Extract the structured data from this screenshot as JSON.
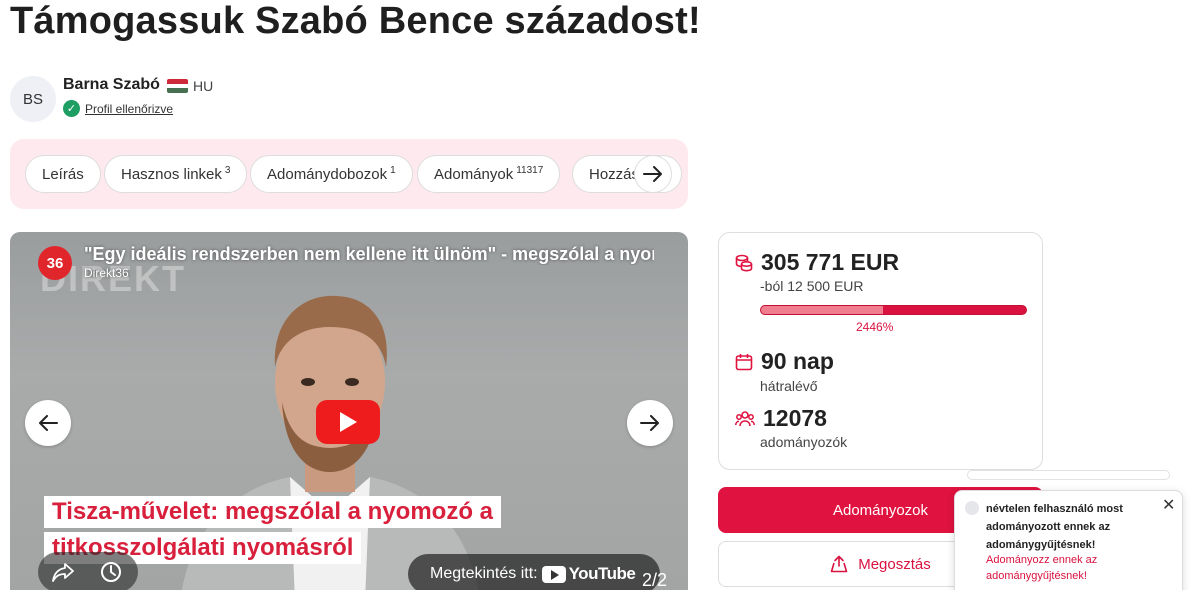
{
  "page": {
    "title": "Támogassuk Szabó Bence századost!"
  },
  "author": {
    "initials": "BS",
    "name": "Barna Szabó",
    "country": "HU",
    "verified_label": "Profil ellenőrizve"
  },
  "tabs": [
    {
      "label": "Leírás",
      "count": ""
    },
    {
      "label": "Hasznos linkek",
      "count": "3"
    },
    {
      "label": "Adománydobozok",
      "count": "1"
    },
    {
      "label": "Adományok",
      "count": "11317"
    },
    {
      "label": "Hozzás",
      "count": ""
    }
  ],
  "video": {
    "logo_text": "36",
    "title": "\"Egy ideális rendszerben nem kellene itt ülnöm\" - megszólal a nyomozó",
    "channel": "Direkt36",
    "watermark": "DIREKT",
    "caption_line1": "Tisza-művelet: megszólal a nyomozó a",
    "caption_line2": "titkosszolgálati nyomásról",
    "watch_on": "Megtekintés itt:",
    "youtube": "YouTube",
    "page_count": "2/2"
  },
  "stats": {
    "raised": "305 771 EUR",
    "goal": "-ból 12 500 EUR",
    "progress_fraction": 0.46,
    "percent": "2446%",
    "days": "90 nap",
    "days_label": "hátralévő",
    "donors": "12078",
    "donors_label": "adományozók"
  },
  "actions": {
    "donate": "Adományozok",
    "share": "Megosztás"
  },
  "notification": {
    "text": "névtelen felhasználó most adományozott ennek az adománygyűjtésnek!",
    "link": "Adományozz ennek az adománygyűjtésnek!",
    "close": "✕"
  },
  "colors": {
    "accent": "#e0123f",
    "tabs_bg": "#fde9ee",
    "verified": "#1e9e63"
  }
}
